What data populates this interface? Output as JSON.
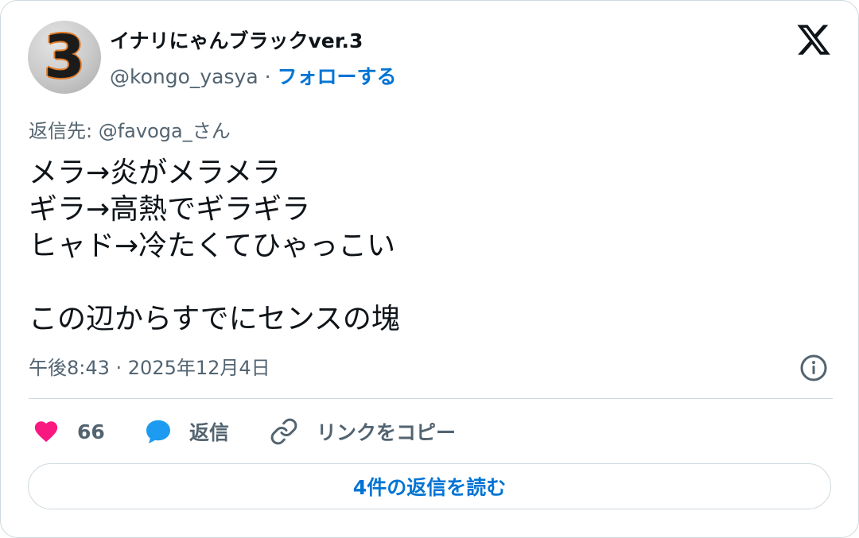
{
  "author": {
    "display_name": "イナリにゃんブラックver.3",
    "handle": "@kongo_yasya",
    "separator": " · ",
    "follow_label": "フォローする",
    "avatar_text": "3"
  },
  "platform": {
    "logo_icon": "x-logo-icon"
  },
  "tweet": {
    "reply_to": "返信先: @favoga_さん",
    "lines": [
      "メラ→炎がメラメラ",
      "ギラ→高熱でギラギラ",
      "ヒャド→冷たくてひゃっこい",
      "",
      "この辺からすでにセンスの塊"
    ],
    "timestamp": "午後8:43 · 2025年12月4日"
  },
  "actions": {
    "like_count": "66",
    "reply_label": "返信",
    "copy_link_label": "リンクをコピー"
  },
  "read_replies_label": "4件の返信を読む",
  "colors": {
    "text": "#0f1419",
    "secondary": "#536471",
    "link": "#0074d4",
    "like": "#f91880",
    "reply_bubble": "#1d9bf0",
    "border": "#cfd9de"
  }
}
